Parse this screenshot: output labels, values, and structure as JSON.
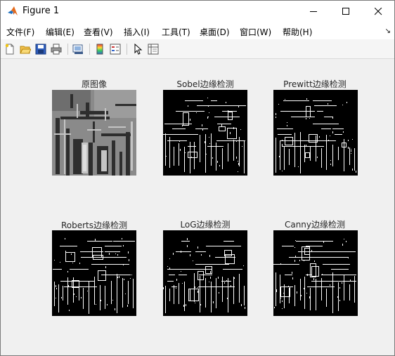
{
  "window": {
    "title": "Figure 1"
  },
  "menu": {
    "items": [
      "文件(F)",
      "编辑(E)",
      "查看(V)",
      "插入(I)",
      "工具(T)",
      "桌面(D)",
      "窗口(W)",
      "帮助(H)"
    ],
    "overflow_symbol": "↘"
  },
  "toolbar": {
    "icons": [
      "new-figure-icon",
      "open-file-icon",
      "save-icon",
      "print-icon",
      "link-plot-icon",
      "insert-colorbar-icon",
      "insert-legend-icon",
      "edit-plot-icon",
      "property-inspector-icon"
    ]
  },
  "subplots": [
    {
      "title": "原图像",
      "kind": "grayscale"
    },
    {
      "title": "Sobel边缘检测",
      "kind": "edges"
    },
    {
      "title": "Prewitt边缘检测",
      "kind": "edges"
    },
    {
      "title": "Roberts边缘检测",
      "kind": "edges"
    },
    {
      "title": "LoG边缘检测",
      "kind": "edges"
    },
    {
      "title": "Canny边缘检测",
      "kind": "edges"
    }
  ]
}
